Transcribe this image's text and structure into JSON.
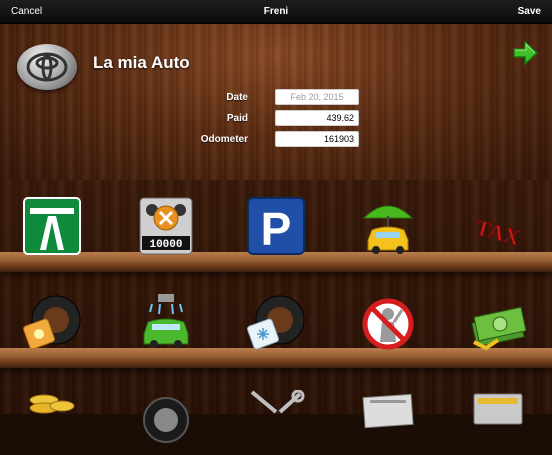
{
  "navbar": {
    "cancel_label": "Cancel",
    "title": "Freni",
    "save_label": "Save"
  },
  "header": {
    "logo_icon": "toyota-logo-icon",
    "car_name": "La mia Auto",
    "next_icon": "green-arrow-right-icon",
    "fields": {
      "date": {
        "label": "Date",
        "value": "Feb 20, 2015"
      },
      "paid": {
        "label": "Paid",
        "value": "439.62"
      },
      "odometer": {
        "label": "Odometer",
        "value": "161903"
      }
    }
  },
  "shelves": {
    "row1": [
      {
        "icon": "highway-sign-icon"
      },
      {
        "icon": "odometer-counter-icon",
        "text": "10000"
      },
      {
        "icon": "parking-sign-icon",
        "text": "P"
      },
      {
        "icon": "car-insurance-umbrella-icon"
      },
      {
        "icon": "tax-icon",
        "text": "TAX"
      }
    ],
    "row2": [
      {
        "icon": "summer-tire-icon"
      },
      {
        "icon": "car-wash-icon"
      },
      {
        "icon": "winter-tire-icon"
      },
      {
        "icon": "no-fine-icon"
      },
      {
        "icon": "money-icon"
      }
    ],
    "row3": [
      {
        "icon": "coins-icon"
      },
      {
        "icon": "wheel-icon"
      },
      {
        "icon": "wrench-tools-icon"
      },
      {
        "icon": "documents-icon"
      },
      {
        "icon": "misc-icon"
      }
    ]
  }
}
